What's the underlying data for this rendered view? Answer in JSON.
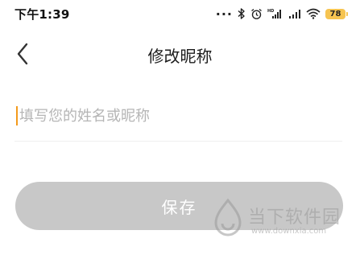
{
  "status_bar": {
    "time": "下午1:39",
    "dots": "...",
    "battery_level": "78",
    "icons": [
      "bluetooth-icon",
      "alarm-icon",
      "hd-signal-icon",
      "signal-icon",
      "wifi-icon",
      "battery-icon"
    ],
    "battery_color": "#f6c451"
  },
  "header": {
    "title": "修改昵称",
    "back_icon": "chevron-left-icon"
  },
  "nickname_field": {
    "placeholder": "填写您的姓名或昵称",
    "value": "",
    "caret_color": "#f39a1c"
  },
  "save_button": {
    "label": "保存",
    "background": "#c8c8c8"
  },
  "watermark": {
    "name": "当下软件园",
    "url": "www.downxia.com"
  }
}
